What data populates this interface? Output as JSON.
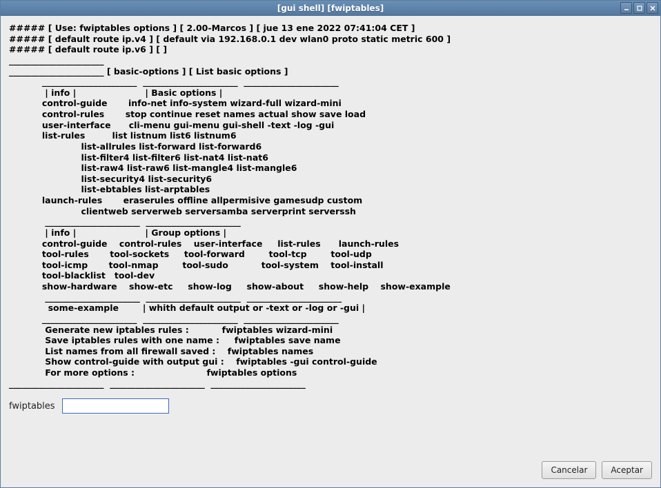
{
  "window": {
    "title": "[gui shell]  [fwiptables]"
  },
  "output": {
    "lines": [
      "##### [ Use: fwiptables options ] [ 2.00-Marcos ] [ jue 13 ene 2022 07:41:04 CET ]",
      "##### [ default route ip.v4 ] [ default via 192.168.0.1 dev wlan0 proto static metric 600 ]",
      "##### [ default route ip.v6 ] [ ]",
      "______________________",
      "______________________ [ basic-options ] [ List basic options ]",
      "           ______________________  ______________________  ______________________",
      "            | info |                       | Basic options |",
      "           control-guide       info-net info-system wizard-full wizard-mini",
      "           control-rules       stop continue reset names actual show save load",
      "           user-interface      cli-menu gui-menu gui-shell -text -log -gui",
      "           list-rules         list listnum list6 listnum6",
      "                        list-allrules list-forward list-forward6",
      "                        list-filter4 list-filter6 list-nat4 list-nat6",
      "                        list-raw4 list-raw6 list-mangle4 list-mangle6",
      "                        list-security4 list-security6",
      "                        list-ebtables list-arptables",
      "           launch-rules       eraserules offline allpermisive gamesudp custom",
      "                        clientweb serverweb serversamba serverprint serverssh",
      "            ______________________  ______________________",
      "            | info |                       | Group options |",
      "           control-guide    control-rules    user-interface     list-rules      launch-rules",
      "           tool-rules       tool-sockets     tool-forward        tool-tcp        tool-udp",
      "           tool-icmp       tool-nmap        tool-sudo           tool-system    tool-install",
      "           tool-blacklist   tool-dev",
      "           show-hardware    show-etc     show-log     show-about     show-help    show-example",
      "            ______________________  ______________________  ______________________",
      "             some-example        | whith default output or -text or -log or -gui |",
      "           ______________________  ______________________  ______________________",
      "            Generate new iptables rules :           fwiptables wizard-mini",
      "            Save iptables rules with one name :     fwiptables save name",
      "            List names from all firewall saved :    fwiptables names",
      "            Show control-guide with output gui :    fwiptables -gui control-guide",
      "            For more options :                        fwiptables options",
      "______________________  ______________________  ______________________"
    ]
  },
  "input": {
    "label": "fwiptables",
    "value": ""
  },
  "buttons": {
    "cancel": "Cancelar",
    "accept": "Aceptar"
  }
}
